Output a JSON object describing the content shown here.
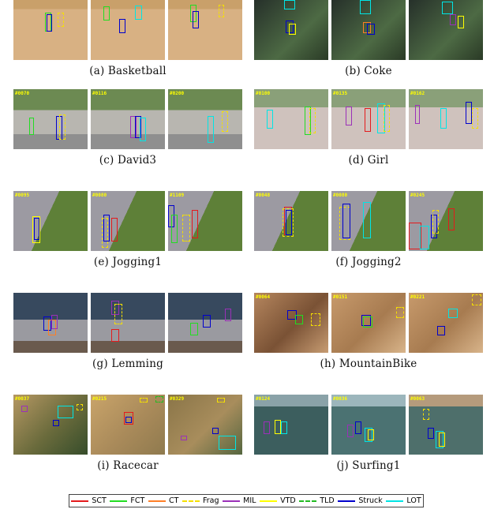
{
  "colors": {
    "SCT": "#e41a1c",
    "FCT": "#22dd22",
    "CT": "#ff7f27",
    "Frag": "#f5e000",
    "MIL": "#9b30b8",
    "VTD": "#ffff00",
    "TLD": "#22bb22",
    "Struck": "#0000cc",
    "LOT": "#00e5e5"
  },
  "legend": [
    {
      "label": "SCT",
      "key": "SCT",
      "dashed": false
    },
    {
      "label": "FCT",
      "key": "FCT",
      "dashed": false
    },
    {
      "label": "CT",
      "key": "CT",
      "dashed": false
    },
    {
      "label": "Frag",
      "key": "Frag",
      "dashed": true
    },
    {
      "label": "MIL",
      "key": "MIL",
      "dashed": false
    },
    {
      "label": "VTD",
      "key": "VTD",
      "dashed": false
    },
    {
      "label": "TLD",
      "key": "TLD",
      "dashed": true
    },
    {
      "label": "Struck",
      "key": "Struck",
      "dashed": false
    },
    {
      "label": "LOT",
      "key": "LOT",
      "dashed": false
    }
  ],
  "sequences": [
    {
      "caption": "(a) Basketball",
      "frames": [
        "",
        "",
        ""
      ]
    },
    {
      "caption": "(b) Coke",
      "frames": [
        "",
        "",
        ""
      ]
    },
    {
      "caption": "(c) David3",
      "frames": [
        "#0070",
        "#0116",
        "#0200"
      ]
    },
    {
      "caption": "(d) Girl",
      "frames": [
        "#0100",
        "#0135",
        "#0162"
      ]
    },
    {
      "caption": "(e) Jogging1",
      "frames": [
        "#0095",
        "#0080",
        "#1109"
      ]
    },
    {
      "caption": "(f) Jogging2",
      "frames": [
        "#0048",
        "#0080",
        "#0245"
      ]
    },
    {
      "caption": "(g) Lemming",
      "frames": [
        "",
        "",
        ""
      ]
    },
    {
      "caption": "(h) MountainBike",
      "frames": [
        "#0064",
        "#0151",
        "#0221"
      ]
    },
    {
      "caption": "(i) Racecar",
      "frames": [
        "#0037",
        "#0215",
        "#0329"
      ]
    },
    {
      "caption": "(j) Surfing1",
      "frames": [
        "#0124",
        "#0036",
        "#0063"
      ]
    }
  ]
}
